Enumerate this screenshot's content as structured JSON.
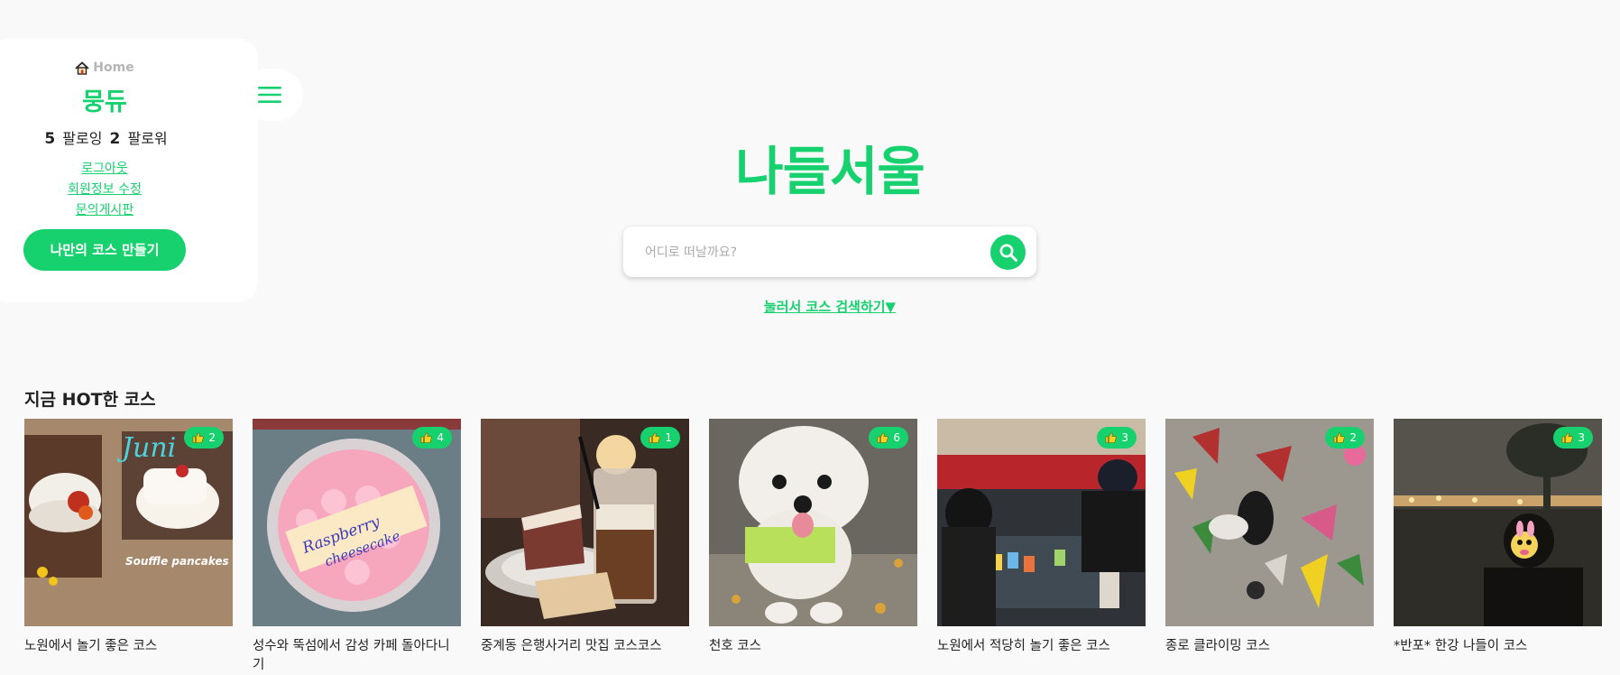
{
  "sidebar": {
    "home_label": "Home",
    "username": "뭉듀",
    "following_count": "5",
    "following_label": "팔로잉",
    "follower_count": "2",
    "follower_label": "팔로워",
    "logout": "로그아웃",
    "edit_profile": "회원정보 수정",
    "inquiry_board": "문의게시판",
    "make_course": "나만의 코스 만들기"
  },
  "brand": "나들서울",
  "search": {
    "placeholder": "어디로 떠날까요?",
    "value": ""
  },
  "course_search_toggle": "눌러서 코스 검색하기▼",
  "hot_section_title": "지금 HOT한 코스",
  "accent_color": "#17d16f",
  "courses": [
    {
      "title": "노원에서 놀기 좋은 코스",
      "likes": "2"
    },
    {
      "title": "성수와 뚝섬에서 감성 카페 돌아다니기",
      "likes": "4"
    },
    {
      "title": "중계동 은행사거리 맛집 코스코스",
      "likes": "1"
    },
    {
      "title": "천호 코스",
      "likes": "6"
    },
    {
      "title": "노원에서 적당히 놀기 좋은 코스",
      "likes": "3"
    },
    {
      "title": "종로 클라이밍 코스",
      "likes": "2"
    },
    {
      "title": "*반포* 한강 나들이 코스",
      "likes": "3"
    }
  ]
}
